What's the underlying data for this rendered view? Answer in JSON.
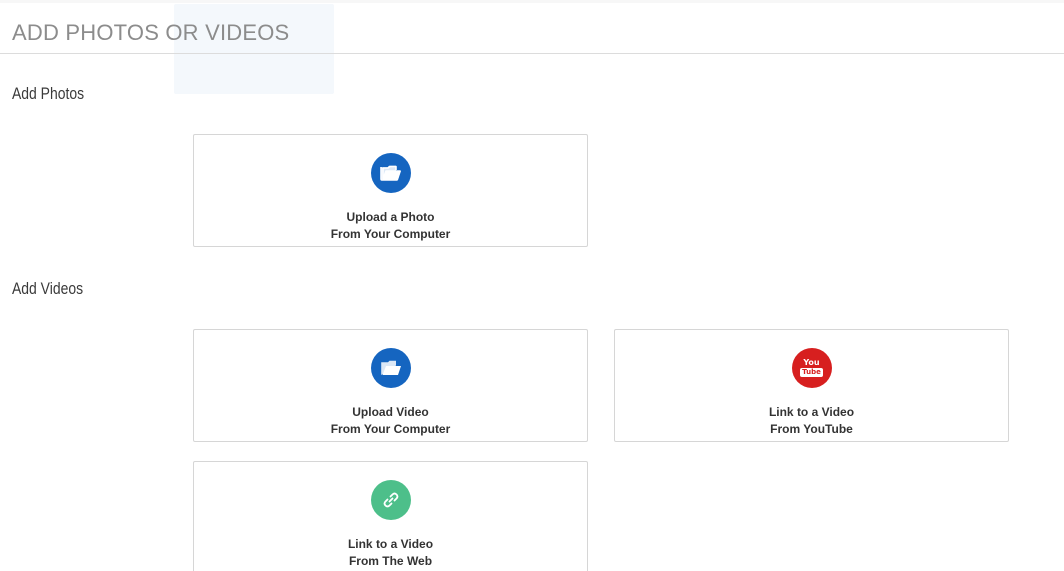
{
  "page": {
    "title": "ADD PHOTOS OR VIDEOS"
  },
  "sections": {
    "photos": {
      "heading": "Add Photos",
      "cards": {
        "upload_photo": {
          "icon": "folder-icon",
          "line1": "Upload a Photo",
          "line2": "From Your Computer"
        }
      }
    },
    "videos": {
      "heading": "Add Videos",
      "cards": {
        "upload_video": {
          "icon": "folder-icon",
          "line1": "Upload Video",
          "line2": "From Your Computer"
        },
        "youtube": {
          "icon": "youtube-icon",
          "icon_text_top": "You",
          "icon_text_bottom": "Tube",
          "line1": "Link to a Video",
          "line2": "From YouTube"
        },
        "web": {
          "icon": "link-icon",
          "line1": "Link to a Video",
          "line2": "From The Web"
        }
      }
    }
  },
  "colors": {
    "folder_icon_bg": "#1565c0",
    "youtube_icon_bg": "#d71f1f",
    "link_icon_bg": "#4dbf8a",
    "title": "#8c8c8c"
  }
}
